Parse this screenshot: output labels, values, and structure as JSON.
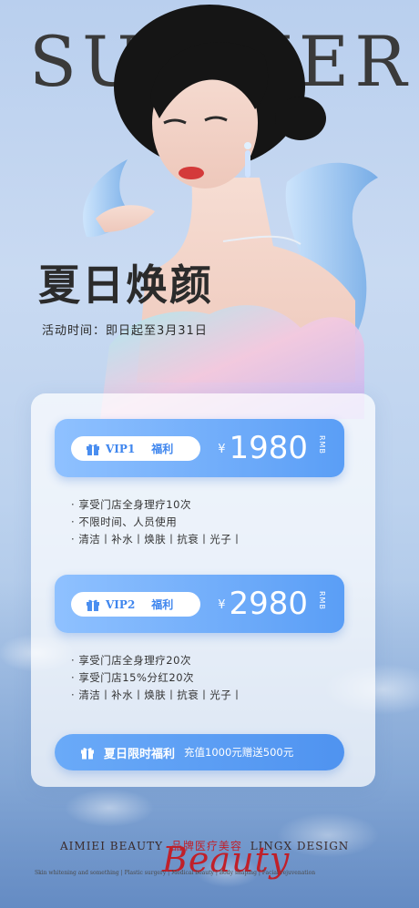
{
  "poster": {
    "background_title": "SUMMER",
    "headline": "夏日焕颜",
    "activity_time": "活动时间：即日起至3月31日"
  },
  "tiers": [
    {
      "label": "VIP1",
      "sub": "福利",
      "currency": "¥",
      "price": "1980",
      "unit": "RMB",
      "benefits": [
        "享受门店全身理疗10次",
        "不限时间、人员使用",
        "清洁丨补水丨焕肤丨抗衰丨光子丨"
      ]
    },
    {
      "label": "VIP2",
      "sub": "福利",
      "currency": "¥",
      "price": "2980",
      "unit": "RMB",
      "benefits": [
        "享受门店全身理疗20次",
        "享受门店15%分红20次",
        "清洁丨补水丨焕肤丨抗衰丨光子丨"
      ]
    }
  ],
  "promo": {
    "title": "夏日限时福利",
    "detail": "充值1000元赠送500元"
  },
  "footer": {
    "brand_en": "AIMIEI BEAUTY",
    "brand_cn": "品牌医疗美容",
    "design": "LINGX DESIGN",
    "script": "Beauty",
    "tagline": "Skin whitening and something | Plastic surgery | Medical beauty | Body shaping | Facial rejuvenation"
  },
  "colors": {
    "accent": "#5a9ef6",
    "brand_red": "#c0202a",
    "text_dark": "#2b2b2b"
  },
  "icons": [
    "gift-icon"
  ]
}
